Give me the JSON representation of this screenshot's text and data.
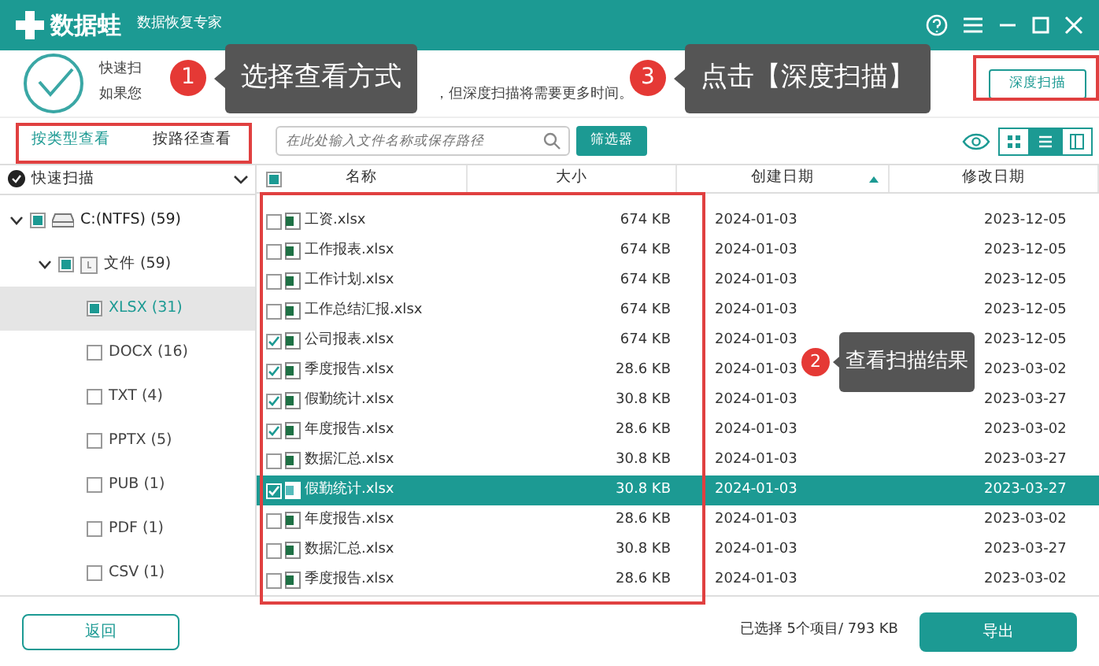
{
  "window": {
    "logo_text": "数据蛙",
    "subtitle": "数据恢复专家"
  },
  "header": {
    "line_1": "快速扫",
    "line_2_start": "如果您",
    "line_2_end": "，但深度扫描将需要更多时间。",
    "deep_scan_button": "深度扫描"
  },
  "callouts": [
    {
      "number": "1",
      "text": "选择查看方式"
    },
    {
      "number": "3",
      "text": "点击【深度扫描】"
    },
    {
      "number": "2",
      "text": "查看扫描结果"
    }
  ],
  "view_tabs": [
    {
      "label": "按类型查看",
      "selected": true
    },
    {
      "label": "按路径查看",
      "selected": false
    }
  ],
  "search": {
    "placeholder": "在此处输入文件名称或保存路径"
  },
  "filter_button": "筛选器",
  "view_modes": [
    {
      "kind": "grid",
      "selected": false
    },
    {
      "kind": "list",
      "selected": true
    },
    {
      "kind": "columns",
      "selected": false
    }
  ],
  "scan_selector": "快速扫描",
  "tree": [
    {
      "label": "C:(NTFS) (59)",
      "kind": "drive",
      "checked": true,
      "expanded": true,
      "selected": false,
      "children": [
        {
          "label": "文件 (59)",
          "kind": "folder",
          "checked": true,
          "expanded": true,
          "selected": false,
          "children": [
            {
              "label": "XLSX (31)",
              "kind": "type",
              "checked": true,
              "selected": true
            },
            {
              "label": "DOCX (16)",
              "kind": "type",
              "checked": false,
              "selected": false
            },
            {
              "label": "TXT (4)",
              "kind": "type",
              "checked": false,
              "selected": false
            },
            {
              "label": "PPTX (5)",
              "kind": "type",
              "checked": false,
              "selected": false
            },
            {
              "label": "PUB (1)",
              "kind": "type",
              "checked": false,
              "selected": false
            },
            {
              "label": "PDF (1)",
              "kind": "type",
              "checked": false,
              "selected": false
            },
            {
              "label": "CSV (1)",
              "kind": "type",
              "checked": false,
              "selected": false
            }
          ]
        }
      ]
    }
  ],
  "table": {
    "select_all_checked": true,
    "columns": [
      "名称",
      "大小",
      "创建日期",
      "修改日期"
    ],
    "rows": [
      {
        "name": "工资.xlsx",
        "size": "674 KB",
        "created": "2024-01-03",
        "modified": "2023-12-05",
        "checked": false,
        "selected": false
      },
      {
        "name": "工作报表.xlsx",
        "size": "674 KB",
        "created": "2024-01-03",
        "modified": "2023-12-05",
        "checked": false,
        "selected": false
      },
      {
        "name": "工作计划.xlsx",
        "size": "674 KB",
        "created": "2024-01-03",
        "modified": "2023-12-05",
        "checked": false,
        "selected": false
      },
      {
        "name": "工作总结汇报.xlsx",
        "size": "674 KB",
        "created": "2024-01-03",
        "modified": "2023-12-05",
        "checked": false,
        "selected": false
      },
      {
        "name": "公司报表.xlsx",
        "size": "674 KB",
        "created": "2024-01-03",
        "modified": "2023-12-05",
        "checked": true,
        "selected": false
      },
      {
        "name": "季度报告.xlsx",
        "size": "28.6 KB",
        "created": "2024-01-03",
        "modified": "2023-03-02",
        "checked": true,
        "selected": false
      },
      {
        "name": "假勤统计.xlsx",
        "size": "30.8 KB",
        "created": "2024-01-03",
        "modified": "2023-03-27",
        "checked": true,
        "selected": false
      },
      {
        "name": "年度报告.xlsx",
        "size": "28.6 KB",
        "created": "2024-01-03",
        "modified": "2023-03-02",
        "checked": true,
        "selected": false
      },
      {
        "name": "数据汇总.xlsx",
        "size": "30.8 KB",
        "created": "2024-01-03",
        "modified": "2023-03-27",
        "checked": false,
        "selected": false
      },
      {
        "name": "假勤统计.xlsx",
        "size": "30.8 KB",
        "created": "2024-01-03",
        "modified": "2023-03-27",
        "checked": true,
        "selected": true
      },
      {
        "name": "年度报告.xlsx",
        "size": "28.6 KB",
        "created": "2024-01-03",
        "modified": "2023-03-02",
        "checked": false,
        "selected": false
      },
      {
        "name": "数据汇总.xlsx",
        "size": "30.8 KB",
        "created": "2024-01-03",
        "modified": "2023-03-27",
        "checked": false,
        "selected": false
      },
      {
        "name": "季度报告.xlsx",
        "size": "28.6 KB",
        "created": "2024-01-03",
        "modified": "2023-03-02",
        "checked": false,
        "selected": false
      }
    ]
  },
  "footer": {
    "back_button": "返回",
    "selection_summary": "已选择 5个项目/ 793 KB",
    "export_button": "导出"
  }
}
